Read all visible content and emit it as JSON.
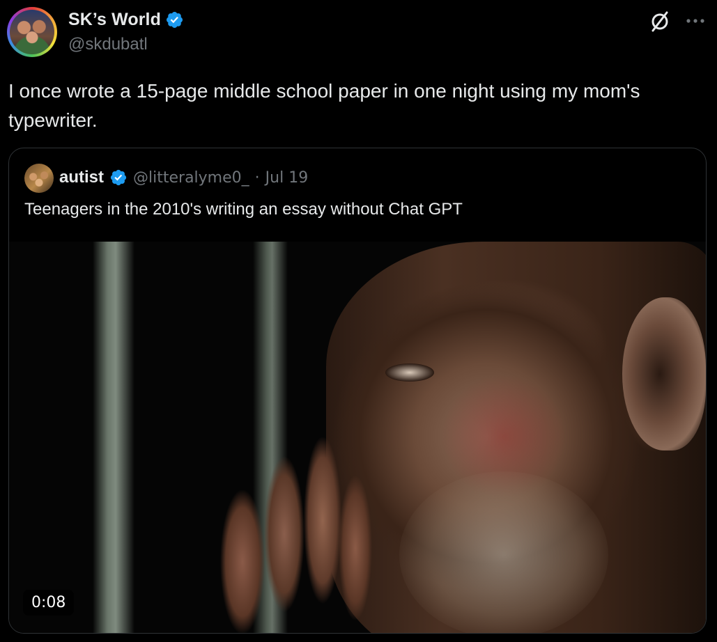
{
  "author": {
    "display_name": "SK’s World",
    "handle": "@skdubatl",
    "verified": true,
    "avatar_icon": "avatar-group-photo-rainbow-ring"
  },
  "tweet": {
    "text": "I once wrote a 15-page middle school paper in one night using my mom's typewriter."
  },
  "header_actions": {
    "grok_icon": "grok-icon",
    "more_icon": "more-horizontal-icon"
  },
  "quoted_tweet": {
    "display_name": "autist",
    "handle": "@litteralyme0_",
    "separator": "·",
    "date": "Jul 19",
    "verified": true,
    "text": "Teenagers in the 2010's writing an essay without Chat GPT",
    "media": {
      "type": "video",
      "duration": "0:08"
    }
  },
  "colors": {
    "background": "#000000",
    "text_primary": "#e7e9ea",
    "text_secondary": "#71767b",
    "verified_blue": "#1d9bf0",
    "border": "#2f3336"
  }
}
